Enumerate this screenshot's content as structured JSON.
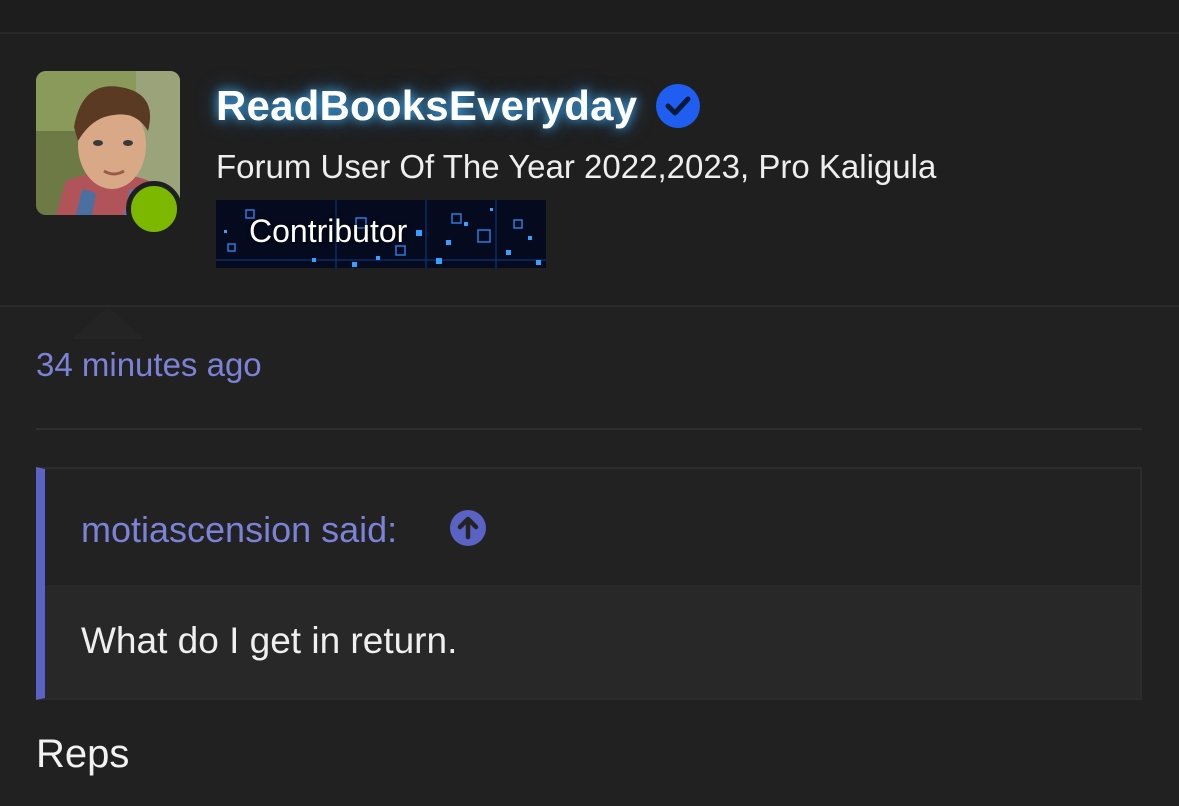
{
  "user": {
    "username": "ReadBooksEveryday",
    "title": "Forum User Of The Year 2022,2023, Pro Kaligula",
    "banner_label": "Contributor",
    "status": "online"
  },
  "post": {
    "timestamp": "34 minutes ago",
    "quote": {
      "author_label": "motiascension said:",
      "text": "What do I get in return."
    },
    "body": "Reps"
  },
  "colors": {
    "background": "#212121",
    "accent": "#7b82d8",
    "quote_bar": "#5a62c4",
    "online": "#7cb800",
    "verified": "#1f5ef0"
  },
  "icons": [
    "verified-badge-icon",
    "arrow-up-circle-icon",
    "online-status-icon"
  ]
}
